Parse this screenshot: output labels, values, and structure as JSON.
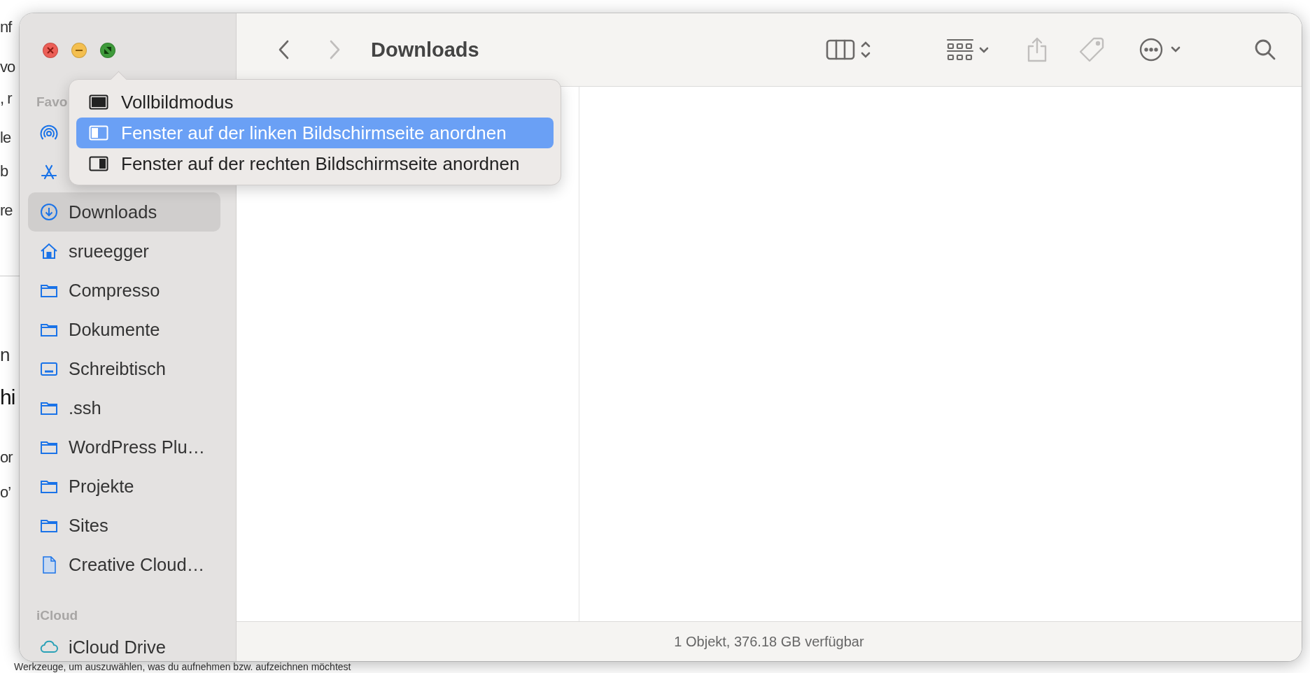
{
  "background_page": {
    "fragments": [
      "nf",
      "vo",
      ", r",
      "le",
      "b",
      "re",
      "n",
      "hi",
      "or",
      "o’"
    ],
    "bottom_text": "Werkzeuge, um auszuwählen, was du aufnehmen bzw. aufzeichnen möchtest"
  },
  "window": {
    "traffic_lights": [
      {
        "kind": "close"
      },
      {
        "kind": "minimize"
      },
      {
        "kind": "zoom"
      }
    ],
    "toolbar": {
      "title": "Downloads",
      "buttons": [
        {
          "kind": "back",
          "disabled": false
        },
        {
          "kind": "forward",
          "disabled": true
        },
        {
          "kind": "columns",
          "disabled": false
        },
        {
          "kind": "group",
          "disabled": false
        },
        {
          "kind": "share",
          "disabled": true
        },
        {
          "kind": "tag",
          "disabled": true
        },
        {
          "kind": "more",
          "disabled": false
        },
        {
          "kind": "search",
          "disabled": false
        }
      ]
    },
    "zoom_menu": {
      "items": [
        {
          "kind": "fullscreen",
          "label": "Vollbildmodus",
          "selected": false
        },
        {
          "kind": "left",
          "label": "Fenster auf der linken Bildschirmseite anordnen",
          "selected": true
        },
        {
          "kind": "right",
          "label": "Fenster auf der rechten Bildschirmseite anordnen",
          "selected": false
        }
      ]
    },
    "sidebar": {
      "sections": [
        {
          "header": "Favo",
          "items": [
            {
              "kind": "airdrop",
              "selected": false
            },
            {
              "kind": "apps",
              "selected": false
            },
            {
              "kind": "download",
              "label": "Downloads",
              "selected": true
            },
            {
              "kind": "home",
              "label": "srueegger",
              "selected": false
            },
            {
              "kind": "folder",
              "label": "Compresso",
              "selected": false
            },
            {
              "kind": "folder",
              "label": "Dokumente",
              "selected": false
            },
            {
              "kind": "desktop",
              "label": "Schreibtisch",
              "selected": false
            },
            {
              "kind": "folder",
              "label": ".ssh",
              "selected": false
            },
            {
              "kind": "folder",
              "label": "WordPress Plu…",
              "selected": false
            },
            {
              "kind": "folder",
              "label": "Projekte",
              "selected": false
            },
            {
              "kind": "folder",
              "label": "Sites",
              "selected": false
            },
            {
              "kind": "document",
              "label": "Creative Cloud…",
              "selected": false
            }
          ]
        },
        {
          "header": "iCloud",
          "items": [
            {
              "kind": "cloud",
              "label": "iCloud Drive",
              "selected": false
            }
          ]
        }
      ]
    },
    "status_bar": "1 Objekt, 376.18 GB verfügbar"
  }
}
